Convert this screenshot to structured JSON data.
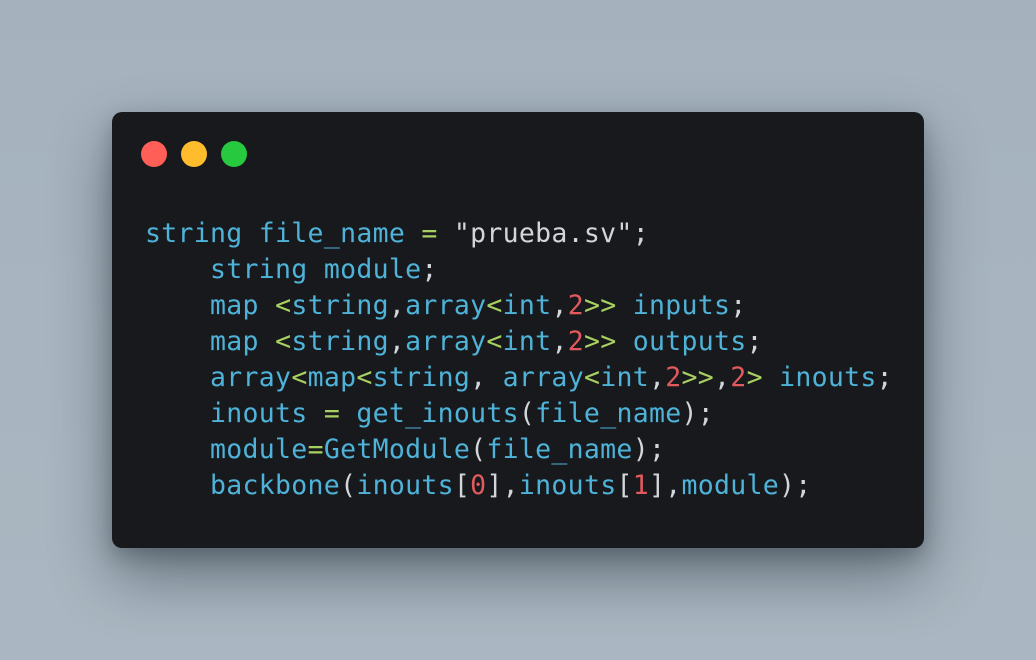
{
  "window": {
    "title_dots": [
      {
        "name": "close",
        "color": "#ff5f56"
      },
      {
        "name": "minimize",
        "color": "#ffbd2e"
      },
      {
        "name": "maximize",
        "color": "#27c93f"
      }
    ]
  },
  "colors": {
    "background": "#a8b5c0",
    "editor_bg": "#17191c",
    "identifier": "#4fb3d9",
    "operator": "#a8d060",
    "number": "#e05a5e",
    "plain": "#d2d6da"
  },
  "code": {
    "lines": [
      [
        {
          "t": "string",
          "c": "kw"
        },
        {
          "t": " ",
          "c": "ws"
        },
        {
          "t": "file_name",
          "c": "id"
        },
        {
          "t": " ",
          "c": "ws"
        },
        {
          "t": "=",
          "c": "op"
        },
        {
          "t": " ",
          "c": "ws"
        },
        {
          "t": "\"prueba.sv\"",
          "c": "str"
        },
        {
          "t": ";",
          "c": "pun"
        }
      ],
      [
        {
          "t": "    ",
          "c": "ws"
        },
        {
          "t": "string",
          "c": "kw"
        },
        {
          "t": " ",
          "c": "ws"
        },
        {
          "t": "module",
          "c": "id"
        },
        {
          "t": ";",
          "c": "pun"
        }
      ],
      [
        {
          "t": "    ",
          "c": "ws"
        },
        {
          "t": "map",
          "c": "kw"
        },
        {
          "t": " ",
          "c": "ws"
        },
        {
          "t": "<",
          "c": "op"
        },
        {
          "t": "string",
          "c": "kw"
        },
        {
          "t": ",",
          "c": "pun"
        },
        {
          "t": "array",
          "c": "kw"
        },
        {
          "t": "<",
          "c": "op"
        },
        {
          "t": "int",
          "c": "kw"
        },
        {
          "t": ",",
          "c": "pun"
        },
        {
          "t": "2",
          "c": "num"
        },
        {
          "t": ">>",
          "c": "op"
        },
        {
          "t": " ",
          "c": "ws"
        },
        {
          "t": "inputs",
          "c": "id"
        },
        {
          "t": ";",
          "c": "pun"
        }
      ],
      [
        {
          "t": "    ",
          "c": "ws"
        },
        {
          "t": "map",
          "c": "kw"
        },
        {
          "t": " ",
          "c": "ws"
        },
        {
          "t": "<",
          "c": "op"
        },
        {
          "t": "string",
          "c": "kw"
        },
        {
          "t": ",",
          "c": "pun"
        },
        {
          "t": "array",
          "c": "kw"
        },
        {
          "t": "<",
          "c": "op"
        },
        {
          "t": "int",
          "c": "kw"
        },
        {
          "t": ",",
          "c": "pun"
        },
        {
          "t": "2",
          "c": "num"
        },
        {
          "t": ">>",
          "c": "op"
        },
        {
          "t": " ",
          "c": "ws"
        },
        {
          "t": "outputs",
          "c": "id"
        },
        {
          "t": ";",
          "c": "pun"
        }
      ],
      [
        {
          "t": "    ",
          "c": "ws"
        },
        {
          "t": "array",
          "c": "kw"
        },
        {
          "t": "<",
          "c": "op"
        },
        {
          "t": "map",
          "c": "kw"
        },
        {
          "t": "<",
          "c": "op"
        },
        {
          "t": "string",
          "c": "kw"
        },
        {
          "t": ",",
          "c": "pun"
        },
        {
          "t": " ",
          "c": "ws"
        },
        {
          "t": "array",
          "c": "kw"
        },
        {
          "t": "<",
          "c": "op"
        },
        {
          "t": "int",
          "c": "kw"
        },
        {
          "t": ",",
          "c": "pun"
        },
        {
          "t": "2",
          "c": "num"
        },
        {
          "t": ">>",
          "c": "op"
        },
        {
          "t": ",",
          "c": "pun"
        },
        {
          "t": "2",
          "c": "num"
        },
        {
          "t": ">",
          "c": "op"
        },
        {
          "t": " ",
          "c": "ws"
        },
        {
          "t": "inouts",
          "c": "id"
        },
        {
          "t": ";",
          "c": "pun"
        }
      ],
      [
        {
          "t": "    ",
          "c": "ws"
        },
        {
          "t": "inouts",
          "c": "id"
        },
        {
          "t": " ",
          "c": "ws"
        },
        {
          "t": "=",
          "c": "op"
        },
        {
          "t": " ",
          "c": "ws"
        },
        {
          "t": "get_inouts",
          "c": "fn"
        },
        {
          "t": "(",
          "c": "pun"
        },
        {
          "t": "file_name",
          "c": "id"
        },
        {
          "t": ");",
          "c": "pun"
        }
      ],
      [
        {
          "t": "    ",
          "c": "ws"
        },
        {
          "t": "module",
          "c": "id"
        },
        {
          "t": "=",
          "c": "op"
        },
        {
          "t": "GetModule",
          "c": "fn"
        },
        {
          "t": "(",
          "c": "pun"
        },
        {
          "t": "file_name",
          "c": "id"
        },
        {
          "t": ");",
          "c": "pun"
        }
      ],
      [
        {
          "t": "    ",
          "c": "ws"
        },
        {
          "t": "backbone",
          "c": "fn"
        },
        {
          "t": "(",
          "c": "pun"
        },
        {
          "t": "inouts",
          "c": "id"
        },
        {
          "t": "[",
          "c": "pun"
        },
        {
          "t": "0",
          "c": "num"
        },
        {
          "t": "],",
          "c": "pun"
        },
        {
          "t": "inouts",
          "c": "id"
        },
        {
          "t": "[",
          "c": "pun"
        },
        {
          "t": "1",
          "c": "num"
        },
        {
          "t": "],",
          "c": "pun"
        },
        {
          "t": "module",
          "c": "id"
        },
        {
          "t": ");",
          "c": "pun"
        }
      ]
    ]
  }
}
